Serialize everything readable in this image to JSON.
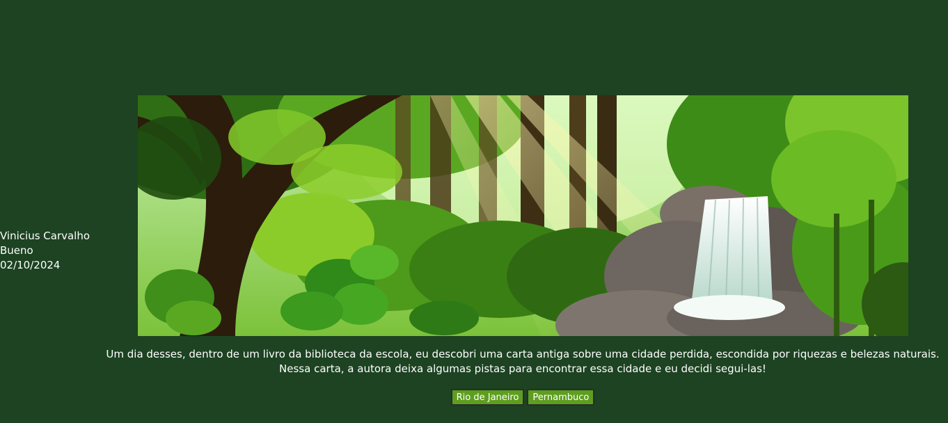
{
  "author": {
    "name_line1": "Vinicius Carvalho",
    "name_line2": "Bueno",
    "date": "02/10/2024"
  },
  "banner": {
    "icon": "forest-waterfall-illustration",
    "colors": {
      "sky": "#b8e6a0",
      "canopy": "#3f8f1a",
      "leaf_light": "#8ccc2a",
      "trunk": "#3a2a14",
      "rock": "#6e6660",
      "water": "#e8f4ee"
    }
  },
  "story": {
    "line1": "Um dia desses, dentro de um livro da biblioteca da escola, eu descobri uma carta antiga sobre uma cidade perdida, escondida por riquezas e belezas naturais.",
    "line2": "Nessa carta, a autora deixa algumas pistas para encontrar essa cidade e eu decidi segui-las!"
  },
  "buttons": {
    "rio_label": "Rio de Janeiro",
    "pernambuco_label": "Pernambuco"
  },
  "theme": {
    "background": "#1d4322",
    "button_bg": "#5e9e1f",
    "text": "#ffffff"
  }
}
